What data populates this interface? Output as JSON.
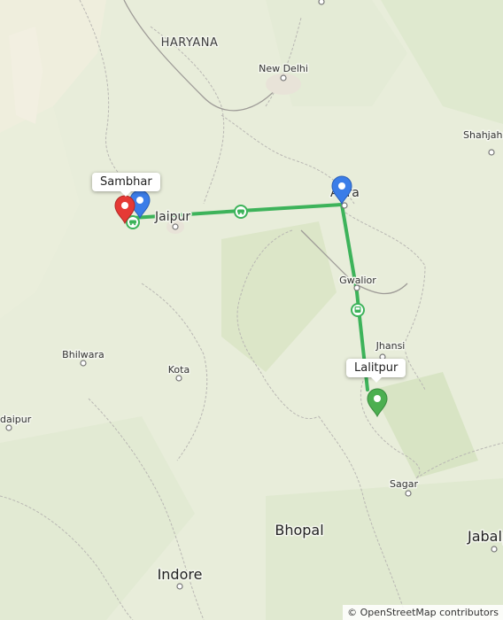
{
  "map": {
    "regions": [
      {
        "id": "haryana",
        "label": "HARYANA"
      }
    ],
    "cities": [
      {
        "id": "new-delhi",
        "label": "New Delhi"
      },
      {
        "id": "shahjahanpur",
        "label": "Shahjaha"
      },
      {
        "id": "jaipur",
        "label": "Jaipur"
      },
      {
        "id": "agra",
        "label": "Agra"
      },
      {
        "id": "gwalior",
        "label": "Gwalior"
      },
      {
        "id": "jhansi",
        "label": "Jhansi"
      },
      {
        "id": "bhilwara",
        "label": "Bhilwara"
      },
      {
        "id": "kota",
        "label": "Kota"
      },
      {
        "id": "udaipur",
        "label": "daipur"
      },
      {
        "id": "sagar",
        "label": "Sagar"
      },
      {
        "id": "bhopal",
        "label": "Bhopal"
      },
      {
        "id": "indore",
        "label": "Indore"
      },
      {
        "id": "jabalpur",
        "label": "Jabalp"
      }
    ],
    "route": {
      "color": "#3db35a",
      "stops": [
        "Sambhar",
        "Jaipur",
        "Agra",
        "Gwalior",
        "Lalitpur"
      ],
      "transport_icons": [
        "car-icon",
        "car-icon",
        "bus-icon"
      ]
    },
    "markers": [
      {
        "id": "sambhar",
        "color": "#e53935",
        "callout": "Sambhar"
      },
      {
        "id": "jaipur-marker",
        "color": "#3b7de8",
        "callout": ""
      },
      {
        "id": "agra-marker",
        "color": "#3b7de8",
        "callout": ""
      },
      {
        "id": "lalitpur",
        "color": "#4caf50",
        "callout": "Lalitpur"
      }
    ],
    "attribution": "© OpenStreetMap contributors"
  }
}
